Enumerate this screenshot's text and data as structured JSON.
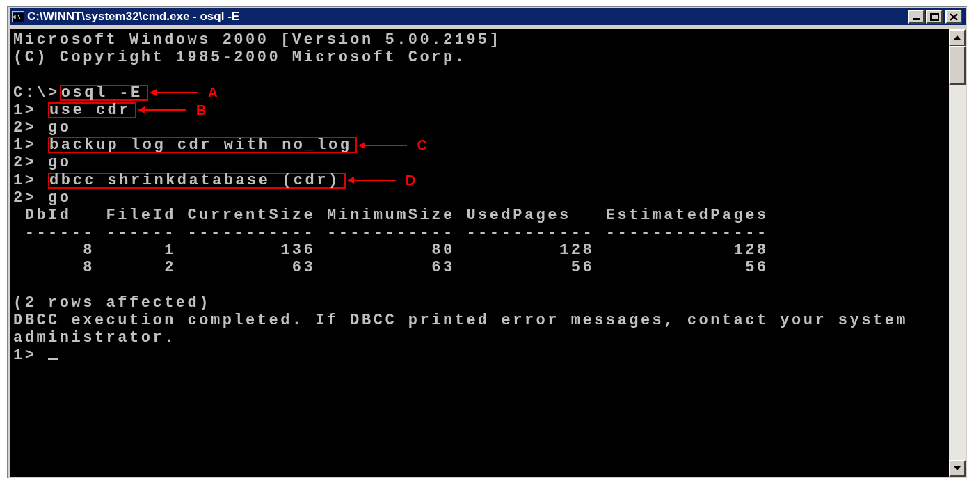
{
  "window": {
    "title": "C:\\WINNT\\system32\\cmd.exe - osql -E"
  },
  "console": {
    "lines": [
      {
        "kind": "plain",
        "text": "Microsoft Windows 2000 [Version 5.00.2195]"
      },
      {
        "kind": "plain",
        "text": "(C) Copyright 1985-2000 Microsoft Corp."
      },
      {
        "kind": "blank"
      },
      {
        "kind": "annotated",
        "prompt": "C:\\>",
        "command": "osql -E",
        "label": "A"
      },
      {
        "kind": "annotated",
        "prompt": "1> ",
        "command": "use cdr",
        "label": "B"
      },
      {
        "kind": "plain",
        "text": "2> go"
      },
      {
        "kind": "annotated",
        "prompt": "1> ",
        "command": "backup log cdr with no_log",
        "label": "C"
      },
      {
        "kind": "plain",
        "text": "2> go"
      },
      {
        "kind": "annotated",
        "prompt": "1> ",
        "command": "dbcc shrinkdatabase (cdr)",
        "label": "D"
      },
      {
        "kind": "plain",
        "text": "2> go"
      },
      {
        "kind": "plain",
        "text": " DbId   FileId CurrentSize MinimumSize UsedPages   EstimatedPages"
      },
      {
        "kind": "plain",
        "text": " ------ ------ ----------- ----------- ----------- --------------"
      },
      {
        "kind": "plain",
        "text": "      8      1         136          80         128            128"
      },
      {
        "kind": "plain",
        "text": "      8      2          63          63          56             56"
      },
      {
        "kind": "blank"
      },
      {
        "kind": "plain",
        "text": "(2 rows affected)"
      },
      {
        "kind": "plain",
        "text": "DBCC execution completed. If DBCC printed error messages, contact your system"
      },
      {
        "kind": "plain",
        "text": "administrator."
      },
      {
        "kind": "cursor",
        "prompt": "1> "
      }
    ]
  }
}
